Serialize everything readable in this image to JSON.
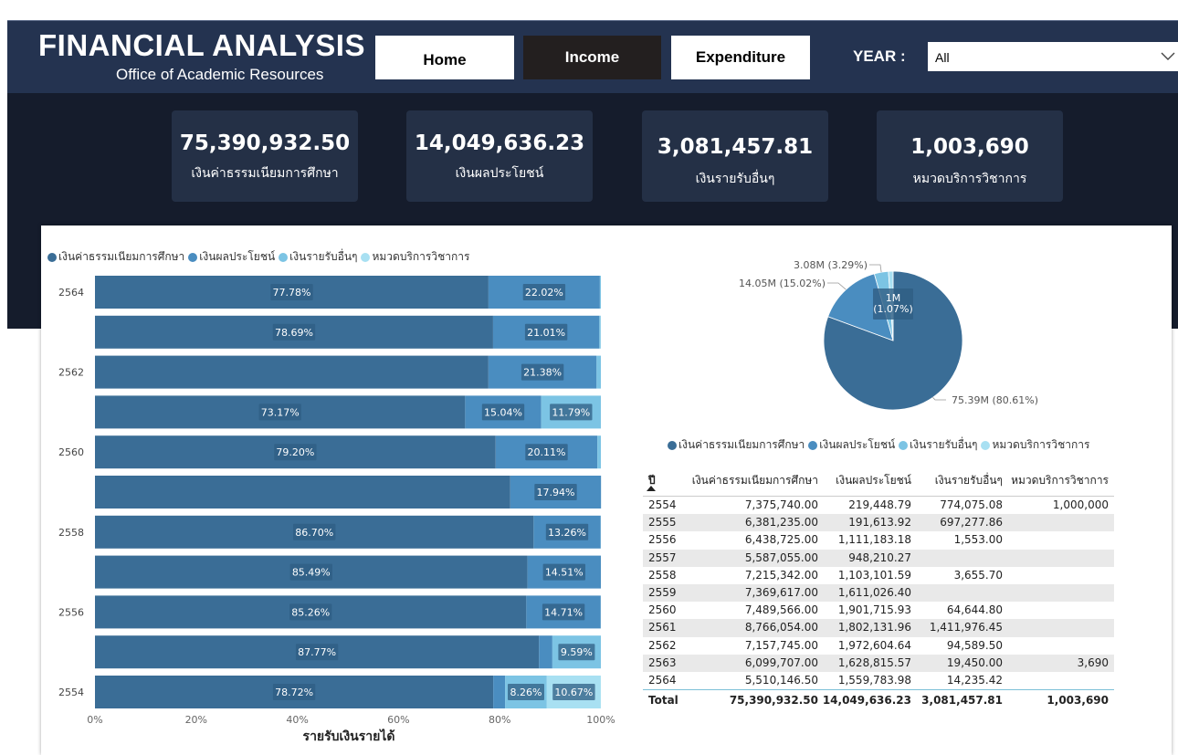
{
  "header": {
    "title": "FINANCIAL ANALYSIS",
    "subtitle": "Office of Academic Resources",
    "nav": {
      "home": "Home",
      "income": "Income",
      "expenditure": "Expenditure"
    },
    "year_label": "YEAR :",
    "year_value": "All"
  },
  "kpis": [
    {
      "value": "75,390,932.50",
      "label": "เงินค่าธรรมเนียมการศึกษา"
    },
    {
      "value": "14,049,636.23",
      "label": "เงินผลประโยชน์"
    },
    {
      "value": "3,081,457.81",
      "label": "เงินรายรับอื่นๆ"
    },
    {
      "value": "1,003,690",
      "label": "หมวดบริการวิชาการ"
    }
  ],
  "colors": {
    "s1": "#3a6d96",
    "s2": "#4a8dc0",
    "s3": "#7cc4e4",
    "s4": "#a8e0f2",
    "label_bg": "#2f5e83"
  },
  "legend": [
    "เงินค่าธรรมเนียมการศึกษา",
    "เงินผลประโยชน์",
    "เงินรายรับอื่นๆ",
    "หมวดบริการวิชาการ"
  ],
  "chart_data": [
    {
      "type": "bar",
      "orientation": "horizontal-100%-stacked",
      "xlabel": "รายรับเงินรายได้",
      "xlim": [
        0,
        100
      ],
      "x_ticks": [
        "0%",
        "20%",
        "40%",
        "60%",
        "80%",
        "100%"
      ],
      "y_tick_labels": [
        "2564",
        "2562",
        "2560",
        "2558",
        "2556",
        "2554"
      ],
      "categories": [
        "2564",
        "2563",
        "2562",
        "2561",
        "2560",
        "2559",
        "2558",
        "2557",
        "2556",
        "2555",
        "2554"
      ],
      "series": [
        {
          "name": "เงินค่าธรรมเนียมการศึกษา",
          "values": [
            77.78,
            78.69,
            77.77,
            73.17,
            79.2,
            82.09,
            86.7,
            85.49,
            85.26,
            87.77,
            78.72
          ]
        },
        {
          "name": "เงินผลประโยชน์",
          "values": [
            22.02,
            21.01,
            21.38,
            15.04,
            20.11,
            17.94,
            13.26,
            14.51,
            14.71,
            2.64,
            2.34
          ]
        },
        {
          "name": "เงินรายรับอื่นๆ",
          "values": [
            0.2,
            0.26,
            0.85,
            11.79,
            0.69,
            0.0,
            0.04,
            0.0,
            0.03,
            9.59,
            8.26
          ]
        },
        {
          "name": "หมวดบริการวิชาการ",
          "values": [
            0,
            0.04,
            0,
            0,
            0,
            0,
            0,
            0,
            0,
            0,
            10.67
          ]
        }
      ],
      "data_labels": [
        [
          "77.78%",
          "22.02%",
          "",
          ""
        ],
        [
          "78.69%",
          "21.01%",
          "",
          ""
        ],
        [
          "",
          "21.38%",
          "",
          ""
        ],
        [
          "73.17%",
          "15.04%",
          "11.79%",
          ""
        ],
        [
          "79.20%",
          "20.11%",
          "",
          ""
        ],
        [
          "",
          "17.94%",
          "",
          ""
        ],
        [
          "86.70%",
          "13.26%",
          "",
          ""
        ],
        [
          "85.49%",
          "14.51%",
          "",
          ""
        ],
        [
          "85.26%",
          "14.71%",
          "",
          ""
        ],
        [
          "87.77%",
          "",
          "9.59%",
          ""
        ],
        [
          "78.72%",
          "",
          "8.26%",
          "10.67%"
        ]
      ]
    },
    {
      "type": "pie",
      "series": [
        {
          "name": "เงินค่าธรรมเนียมการศึกษา",
          "value": 75.39
        },
        {
          "name": "เงินผลประโยชน์",
          "value": 14.05
        },
        {
          "name": "เงินรายรับอื่นๆ",
          "value": 3.08
        },
        {
          "name": "หมวดบริการวิชาการ",
          "value": 1.0
        }
      ],
      "labels": [
        "75.39M (80.61%)",
        "14.05M (15.02%)",
        "3.08M (3.29%)",
        "1M\n(1.07%)"
      ]
    },
    {
      "type": "table",
      "columns": [
        "ปี",
        "เงินค่าธรรมเนียมการศึกษา",
        "เงินผลประโยชน์",
        "เงินรายรับอื่นๆ",
        "หมวดบริการวิชาการ"
      ],
      "rows": [
        [
          "2554",
          "7,375,740.00",
          "219,448.79",
          "774,075.08",
          "1,000,000"
        ],
        [
          "2555",
          "6,381,235.00",
          "191,613.92",
          "697,277.86",
          ""
        ],
        [
          "2556",
          "6,438,725.00",
          "1,111,183.18",
          "1,553.00",
          ""
        ],
        [
          "2557",
          "5,587,055.00",
          "948,210.27",
          "",
          ""
        ],
        [
          "2558",
          "7,215,342.00",
          "1,103,101.59",
          "3,655.70",
          ""
        ],
        [
          "2559",
          "7,369,617.00",
          "1,611,026.40",
          "",
          ""
        ],
        [
          "2560",
          "7,489,566.00",
          "1,901,715.93",
          "64,644.80",
          ""
        ],
        [
          "2561",
          "8,766,054.00",
          "1,802,131.96",
          "1,411,976.45",
          ""
        ],
        [
          "2562",
          "7,157,745.00",
          "1,972,604.64",
          "94,589.50",
          ""
        ],
        [
          "2563",
          "6,099,707.00",
          "1,628,815.57",
          "19,450.00",
          "3,690"
        ],
        [
          "2564",
          "5,510,146.50",
          "1,559,783.98",
          "14,235.42",
          ""
        ]
      ],
      "total": [
        "Total",
        "75,390,932.50",
        "14,049,636.23",
        "3,081,457.81",
        "1,003,690"
      ]
    }
  ]
}
